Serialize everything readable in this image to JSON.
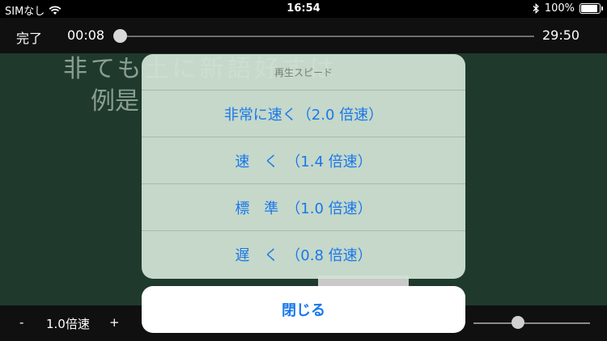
{
  "status_bar": {
    "carrier": "SIMなし",
    "time": "16:54",
    "battery_percent": "100%",
    "battery_level": 1.0
  },
  "player": {
    "done_label": "完了",
    "current_time": "00:08",
    "duration": "29:50",
    "progress": 0.004
  },
  "bottom_bar": {
    "minus_label": "-",
    "speed_label": "1.0倍速",
    "plus_label": "+",
    "volume": 0.38
  },
  "board": {
    "line1": "非ても土に新語好すは",
    "line2": "例是"
  },
  "sheet": {
    "title": "再生スピード",
    "options": [
      {
        "label": "非常に速く（2.0 倍速）"
      },
      {
        "label": "速　く　（1.4 倍速）"
      },
      {
        "label": "標　準　（1.0 倍速）"
      },
      {
        "label": "遅　く　（0.8 倍速）"
      }
    ],
    "close_label": "閉じる"
  },
  "colors": {
    "accent": "#1a78ea",
    "board": "#1f3a2c"
  }
}
